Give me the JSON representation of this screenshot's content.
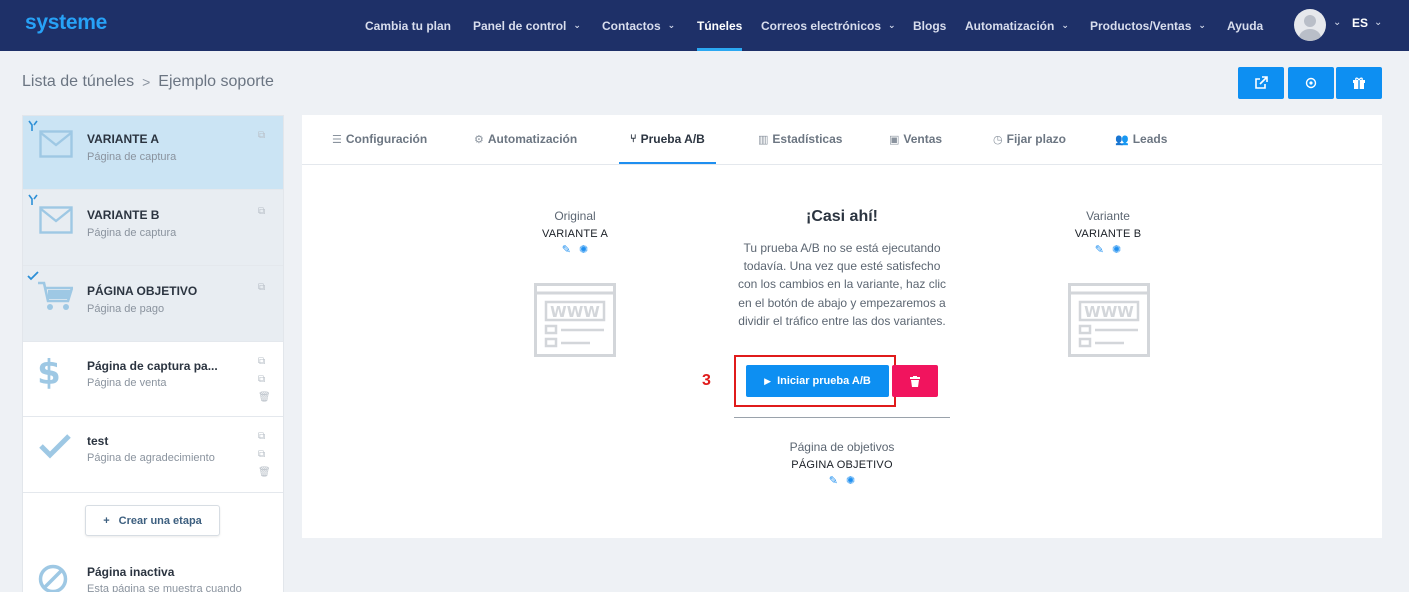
{
  "brand": {
    "logo": "systeme",
    "accent": "#1e8ff0",
    "nav_bg": "#1e3068",
    "danger": "#f1145e",
    "highlight": "#e01b1b"
  },
  "nav": {
    "items": [
      {
        "label": "Cambia tu plan",
        "dropdown": false
      },
      {
        "label": "Panel de control",
        "dropdown": true
      },
      {
        "label": "Contactos",
        "dropdown": true
      },
      {
        "label": "Túneles",
        "dropdown": false,
        "active": true
      },
      {
        "label": "Correos electrónicos",
        "dropdown": true
      },
      {
        "label": "Blogs",
        "dropdown": false
      },
      {
        "label": "Automatización",
        "dropdown": true
      },
      {
        "label": "Productos/Ventas",
        "dropdown": true
      },
      {
        "label": "Ayuda",
        "dropdown": false
      }
    ],
    "language": "ES"
  },
  "breadcrumb": {
    "root": "Lista de túneles",
    "current": "Ejemplo soporte"
  },
  "toolbar": {
    "icons": [
      "external-link-icon",
      "settings-icon",
      "gift-icon"
    ]
  },
  "sidebar": {
    "steps": [
      {
        "title": "VARIANTE A",
        "subtitle": "Página de captura",
        "icon": "envelope-icon"
      },
      {
        "title": "VARIANTE B",
        "subtitle": "Página de captura",
        "icon": "envelope-icon"
      },
      {
        "title": "PÁGINA OBJETIVO",
        "subtitle": "Página de pago",
        "icon": "cart-icon"
      },
      {
        "title": "Página de captura pa...",
        "subtitle": "Página de venta",
        "icon": "dollar-icon"
      },
      {
        "title": "test",
        "subtitle": "Página de agradecimiento",
        "icon": "checkmark-icon"
      }
    ],
    "create_label": "Crear una etapa",
    "inactive": {
      "title": "Página inactiva",
      "subtitle": "Esta página se muestra cuando"
    }
  },
  "tabs": [
    {
      "label": "Configuración",
      "icon": "list-icon"
    },
    {
      "label": "Automatización",
      "icon": "gears-icon"
    },
    {
      "label": "Prueba A/B",
      "icon": "split-icon",
      "active": true
    },
    {
      "label": "Estadísticas",
      "icon": "bar-chart-icon"
    },
    {
      "label": "Ventas",
      "icon": "money-icon"
    },
    {
      "label": "Fijar plazo",
      "icon": "clock-icon"
    },
    {
      "label": "Leads",
      "icon": "users-icon"
    }
  ],
  "ab": {
    "original": {
      "label": "Original",
      "name": "VARIANTE A"
    },
    "variant": {
      "label": "Variante",
      "name": "VARIANTE B"
    },
    "title": "¡Casi ahí!",
    "description": "Tu prueba A/B no se está ejecutando todavía. Una vez que esté satisfecho con los cambios en la variante, haz clic en el botón de abajo y empezaremos a dividir el tráfico entre las dos variantes.",
    "start_label": "Iniciar prueba A/B",
    "annotation": "3",
    "goal": {
      "label": "Página de objetivos",
      "name": "PÁGINA OBJETIVO"
    }
  }
}
